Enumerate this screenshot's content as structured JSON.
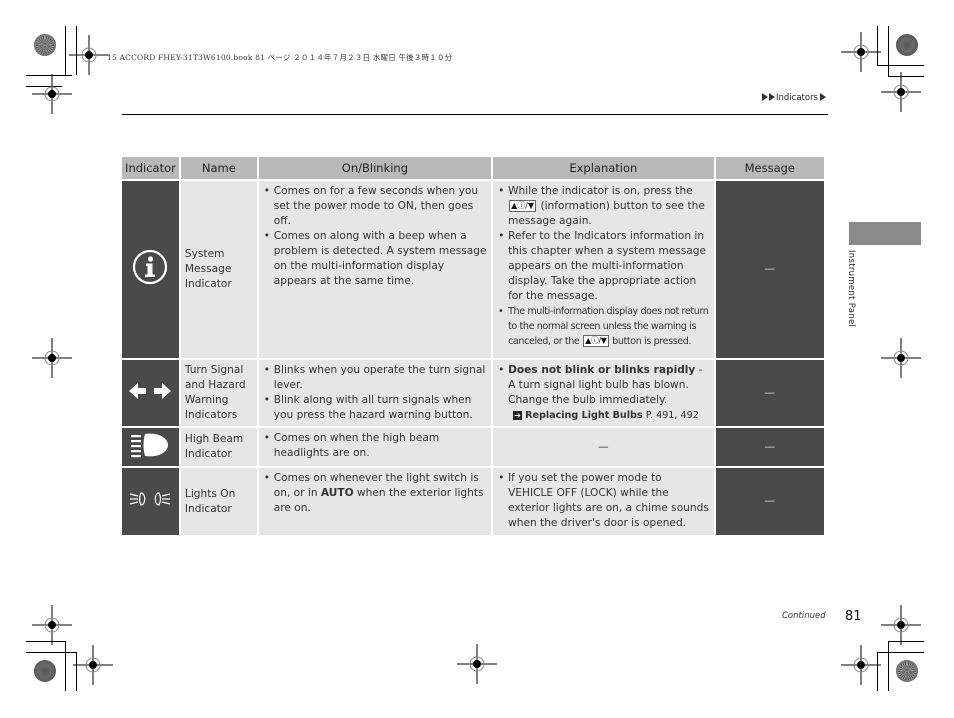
{
  "print_header": "15 ACCORD FHEY-31T3W6100.book  81 ページ  ２０１４年７月２３日  水曜日  午後３時１０分",
  "breadcrumb": {
    "section": "Indicators"
  },
  "side_tab": {
    "label": "Instrument Panel"
  },
  "table": {
    "headers": [
      "Indicator",
      "Name",
      "On/Blinking",
      "Explanation",
      "Message"
    ],
    "rows": [
      {
        "icon": "information-circle-icon",
        "name": "System Message Indicator",
        "on_blinking": [
          "Comes on for a few seconds when you set the power mode to ON, then goes off.",
          "Comes on along with a beep when a problem is detected. A system message on the multi-information display appears at the same time."
        ],
        "explanation": {
          "b1_pre": "While the indicator is on, press the",
          "b1_button": "▲ⓘ/▼",
          "b1_post": "(information) button to see the message again.",
          "b2": "Refer to the Indicators information in this chapter when a system message appears on the multi-information display. Take the appropriate action for the message.",
          "b3_pre": "The multi-information display does not return to the normal screen unless the warning is canceled, or the",
          "b3_button": "▲ⓘ/▼",
          "b3_post": "button is pressed."
        },
        "message": "—"
      },
      {
        "icon": "turn-signal-arrows-icon",
        "name": "Turn Signal and Hazard Warning Indicators",
        "on_blinking": [
          "Blinks when you operate the turn signal lever.",
          "Blink along with all turn signals when you press the hazard warning button."
        ],
        "explanation": {
          "bold": "Does not blink or blinks rapidly",
          "text": " - A turn signal light bulb has blown. Change the bulb immediately.",
          "xref_title": "Replacing Light Bulbs",
          "xref_pages": "P. 491, 492"
        },
        "message": "—"
      },
      {
        "icon": "high-beam-icon",
        "name": "High Beam Indicator",
        "on_blinking": [
          "Comes on when the high beam headlights are on."
        ],
        "explanation": "—",
        "message": "—"
      },
      {
        "icon": "lights-on-icon",
        "name": "Lights On Indicator",
        "on_blinking": {
          "pre": "Comes on whenever the light switch is on, or in ",
          "bold": "AUTO",
          "post": " when the exterior lights are on."
        },
        "explanation": [
          "If you set the power mode to VEHICLE OFF (LOCK) while the exterior lights are on, a chime sounds when the driver's door is opened."
        ],
        "message": "—"
      }
    ]
  },
  "footer": {
    "continued": "Continued",
    "page_number": "81"
  }
}
